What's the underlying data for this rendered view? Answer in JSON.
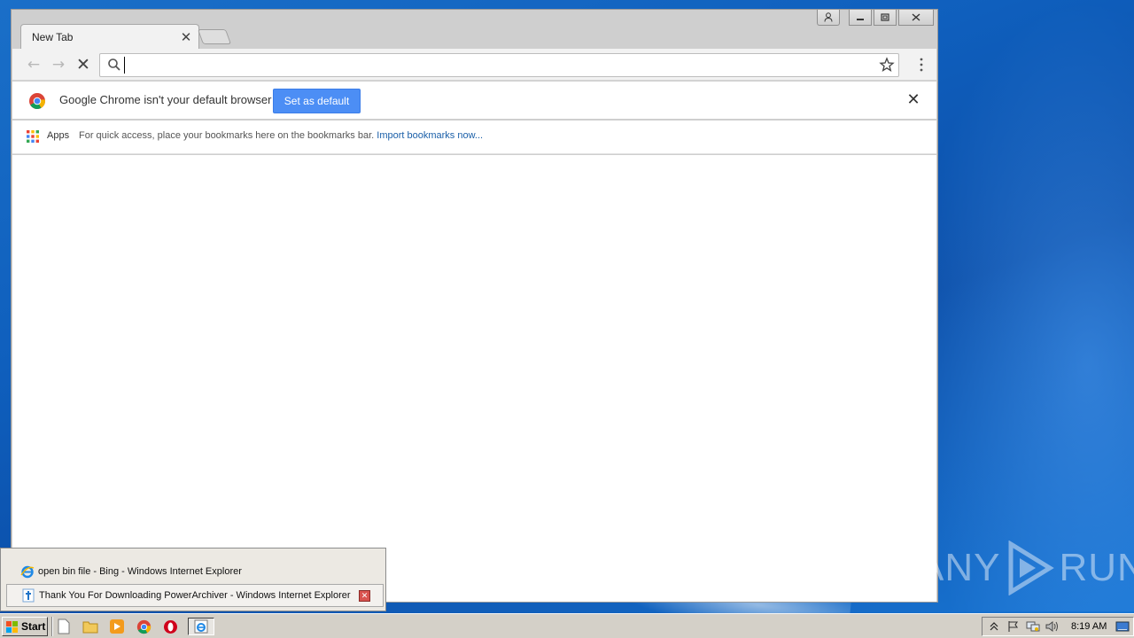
{
  "browser": {
    "tab_title": "New Tab",
    "omnibox_value": "",
    "infobar": {
      "message": "Google Chrome isn't your default browser",
      "button_label": "Set as default"
    },
    "bookmarks": {
      "apps_label": "Apps",
      "hint": "For quick access, place your bookmarks here on the bookmarks bar.",
      "import_link": "Import bookmarks now..."
    }
  },
  "taskbar_popup": {
    "items": [
      {
        "label": "open bin file - Bing - Windows Internet Explorer",
        "icon": "ie-icon"
      },
      {
        "label": "Thank You For Downloading PowerArchiver - Windows Internet Explorer",
        "icon": "page-icon"
      }
    ]
  },
  "taskbar": {
    "start_label": "Start",
    "clock": "8:19 AM"
  },
  "watermark": {
    "left": "ANY",
    "right": "RUN"
  },
  "colors": {
    "accent": "#4c8ef5",
    "link": "#1a5fa8",
    "desktop": "#1565c0"
  }
}
